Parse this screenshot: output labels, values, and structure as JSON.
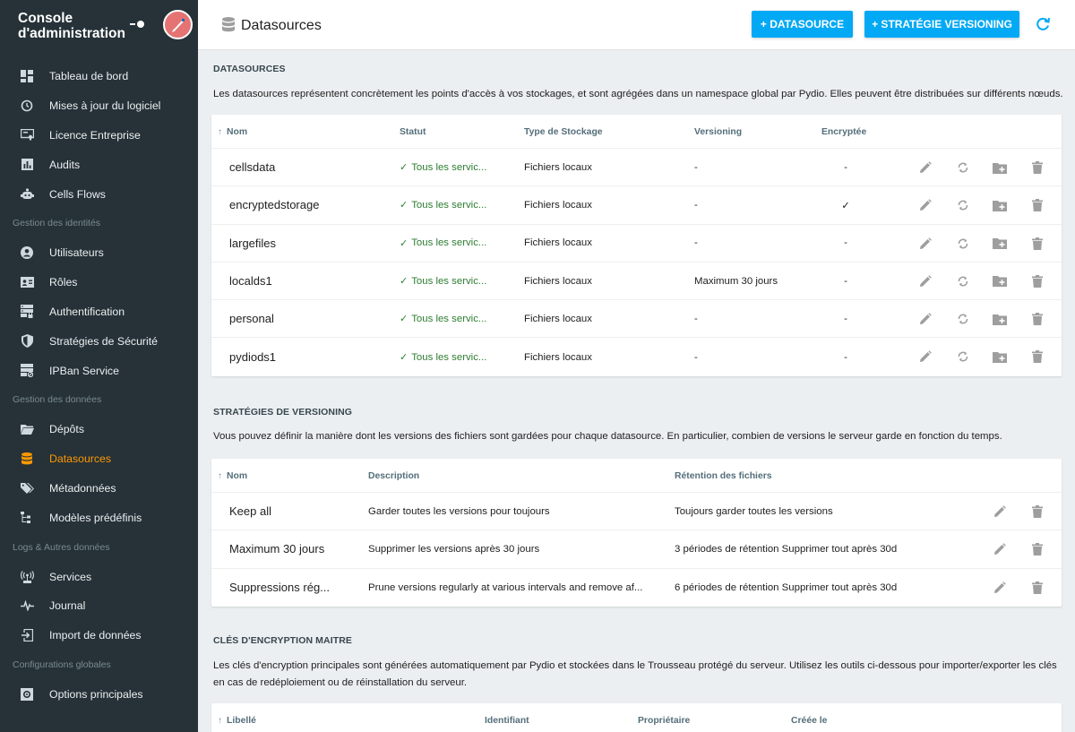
{
  "sidebar": {
    "title": "Console d'administration",
    "items": [
      {
        "label": "Tableau de bord",
        "icon": "dashboard-icon"
      },
      {
        "label": "Mises à jour du logiciel",
        "icon": "update-icon"
      },
      {
        "label": "Licence Entreprise",
        "icon": "license-icon"
      },
      {
        "label": "Audits",
        "icon": "audit-icon"
      },
      {
        "label": "Cells Flows",
        "icon": "flows-icon"
      }
    ],
    "section_identities": "Gestion des identités",
    "identities": [
      {
        "label": "Utilisateurs",
        "icon": "user-icon"
      },
      {
        "label": "Rôles",
        "icon": "roles-icon"
      },
      {
        "label": "Authentification",
        "icon": "auth-icon"
      },
      {
        "label": "Stratégies de Sécurité",
        "icon": "shield-icon"
      },
      {
        "label": "IPBan Service",
        "icon": "ipban-icon"
      }
    ],
    "section_data": "Gestion des données",
    "data_items": [
      {
        "label": "Dépôts",
        "icon": "folder-icon"
      },
      {
        "label": "Datasources",
        "icon": "database-icon"
      },
      {
        "label": "Métadonnées",
        "icon": "tag-icon"
      },
      {
        "label": "Modèles prédéfinis",
        "icon": "tree-icon"
      }
    ],
    "section_logs": "Logs & Autres données",
    "logs_items": [
      {
        "label": "Services",
        "icon": "services-icon"
      },
      {
        "label": "Journal",
        "icon": "pulse-icon"
      },
      {
        "label": "Import de données",
        "icon": "import-icon"
      }
    ],
    "section_config": "Configurations globales",
    "config_items": [
      {
        "label": "Options principales",
        "icon": "settings-icon"
      }
    ]
  },
  "header": {
    "title": "Datasources",
    "btn_datasource": "+ DATASOURCE",
    "btn_versioning": "+ STRATÉGIE VERSIONING"
  },
  "datasources": {
    "title": "DATASOURCES",
    "description": "Les datasources représentent concrètement les points d'accès à vos stockages, et sont agrégées dans un namespace global par Pydio. Elles peuvent être distribuées sur différents nœuds.",
    "columns": [
      "Nom",
      "Statut",
      "Type de Stockage",
      "Versioning",
      "Encryptée"
    ],
    "rows": [
      {
        "name": "cellsdata",
        "status": "Tous les servic...",
        "storage": "Fichiers locaux",
        "versioning": "-",
        "encrypted": "-"
      },
      {
        "name": "encryptedstorage",
        "status": "Tous les servic...",
        "storage": "Fichiers locaux",
        "versioning": "-",
        "encrypted": "✓"
      },
      {
        "name": "largefiles",
        "status": "Tous les servic...",
        "storage": "Fichiers locaux",
        "versioning": "-",
        "encrypted": "-"
      },
      {
        "name": "localds1",
        "status": "Tous les servic...",
        "storage": "Fichiers locaux",
        "versioning": "Maximum 30 jours",
        "encrypted": "-"
      },
      {
        "name": "personal",
        "status": "Tous les servic...",
        "storage": "Fichiers locaux",
        "versioning": "-",
        "encrypted": "-"
      },
      {
        "name": "pydiods1",
        "status": "Tous les servic...",
        "storage": "Fichiers locaux",
        "versioning": "-",
        "encrypted": "-"
      }
    ]
  },
  "versioning": {
    "title": "STRATÉGIES DE VERSIONING",
    "description": "Vous pouvez définir la manière dont les versions des fichiers sont gardées pour chaque datasource. En particulier, combien de versions le serveur garde en fonction du temps.",
    "columns": [
      "Nom",
      "Description",
      "Rétention des fichiers"
    ],
    "rows": [
      {
        "name": "Keep all",
        "description": "Garder toutes les versions pour toujours",
        "retention": "Toujours garder toutes les versions"
      },
      {
        "name": "Maximum 30 jours",
        "description": "Supprimer les versions après 30 jours",
        "retention": "3 périodes de rétention Supprimer tout après 30d"
      },
      {
        "name": "Suppressions rég...",
        "description": "Prune versions regularly at various intervals and remove af...",
        "retention": "6 périodes de rétention Supprimer tout après 30d"
      }
    ]
  },
  "encryption": {
    "title": "CLÉS D'ENCRYPTION MAITRE",
    "description": "Les clés d'encryption principales sont générées automatiquement par Pydio et stockées dans le Trousseau protégé du serveur. Utilisez les outils ci-dessous pour importer/exporter les clés en cas de redéploiement ou de réinstallation du serveur.",
    "columns": [
      "Libellé",
      "Identifiant",
      "Propriétaire",
      "Créée le"
    ]
  },
  "colors": {
    "sidebar_bg": "#263238",
    "accent": "#03a9f4",
    "active": "#ff9800",
    "status_ok": "#2e7d32"
  }
}
